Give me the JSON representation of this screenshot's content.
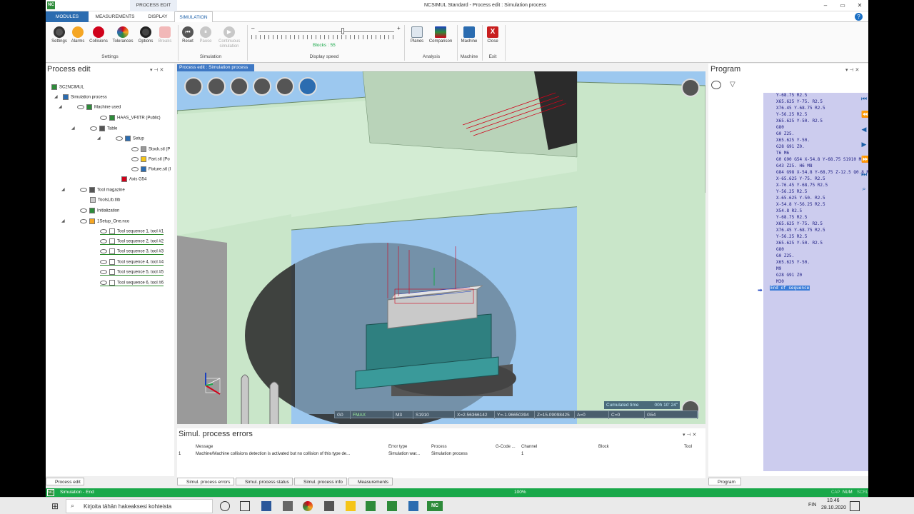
{
  "window": {
    "title": "NCSIMUL Standard - Process edit : Simulation process",
    "context_tab": "PROCESS EDIT",
    "logo": "NC",
    "controls": {
      "minimize": "–",
      "maximize": "▭",
      "close": "✕"
    }
  },
  "ribbon_tabs": [
    "MODULES",
    "MEASUREMENTS",
    "DISPLAY",
    "SIMULATION"
  ],
  "ribbon": {
    "settings_group": {
      "label": "Settings",
      "buttons": [
        "Settings",
        "Alarms",
        "Collisions",
        "Tolerances",
        "Options",
        "Breaks"
      ]
    },
    "simulation_group": {
      "label": "Simulation",
      "buttons": [
        "Reset",
        "Pause",
        "Continuous",
        "simulation"
      ]
    },
    "display_speed": {
      "label": "Display speed",
      "blocks": "Blocks : 55",
      "minus": "–",
      "plus": "+"
    },
    "analysis_group": {
      "label": "Analysis",
      "buttons": [
        "Planes",
        "Comparison"
      ]
    },
    "machine_group": {
      "label": "Machine",
      "buttons": [
        "Machine"
      ]
    },
    "exit_group": {
      "label": "Exit",
      "buttons": [
        "Close"
      ]
    }
  },
  "process_edit": {
    "title": "Process edit",
    "tree": [
      "SC2NCIMUL",
      "Simulation process",
      "Machine used",
      "HAAS_VF6TR (Public)",
      "Table",
      "Setup",
      "Stock.stl (P",
      "Part.stl (Po",
      "Fixture.stl (I",
      "Axis G54",
      "Tool magazine",
      "ToolsLib.tlib",
      "Initialization",
      "1Setup_One.nco",
      "Tool sequence 1, tool #1",
      "Tool sequence 2, tool #2",
      "Tool sequence 3, tool #3",
      "Tool sequence 4, tool #4",
      "Tool sequence 5, tool #5",
      "Tool sequence 6, tool #6"
    ],
    "bottom_tab": "Process edit"
  },
  "viewport": {
    "tab": "Process edit : Simulation process",
    "cumulated_label": "Cumulated time",
    "cumulated_value": "00h 10' 24\"",
    "status": [
      "G0",
      "FMAX",
      "M3",
      "S1910",
      "X=2.56366142",
      "Y=-1.96650394",
      "Z=15.09098425",
      "A=0",
      "C=0",
      "G54"
    ]
  },
  "program": {
    "title": "Program",
    "lines": [
      "Y-68.75 R2.5",
      "X65.625 Y-75. R2.5",
      "X76.45 Y-68.75 R2.5",
      "Y-56.25 R2.5",
      "X65.625 Y-50. R2.5",
      "G80",
      "G0 Z25.",
      "X65.625 Y-50.",
      "G28 G91 Z0.",
      "T6 M6",
      "G0 G90 G54 X-54.8 Y-68.75 S1910 M3",
      "G43 Z25. H6 M8",
      "G84 G98 X-54.8 Y-68.75 Z-12.5 Q0.8 R2.5",
      "X-65.625 Y-75. R2.5",
      "X-76.45 Y-68.75 R2.5",
      "Y-56.25 R2.5",
      "X-65.625 Y-50. R2.5",
      "X-54.8 Y-56.25 R2.5",
      "X54.8 R2.5",
      "Y-68.75 R2.5",
      "X65.625 Y-75. R2.5",
      "X76.45 Y-68.75 R2.5",
      "Y-56.25 R2.5",
      "X65.625 Y-50. R2.5",
      "G80",
      "G0 Z25.",
      "X65.625 Y-50.",
      "M9",
      "G28 G91 Z0",
      "M30",
      "End of sequence"
    ],
    "bottom_tab": "Program"
  },
  "errors": {
    "title": "Simul. process errors",
    "columns": [
      "Message",
      "Error type",
      "Process",
      "G-Code ...",
      "Channel",
      "Block",
      "Tool"
    ],
    "rows": [
      [
        "1",
        "Machine/Machine collisions detection is activated but no collision of this type de...",
        "Simulation war...",
        "Simulation process",
        "",
        "1",
        "",
        ""
      ]
    ],
    "tabs": [
      "Simul. process errors",
      "Simul. process status",
      "Simul. process info",
      "Measurements"
    ]
  },
  "status_strip": {
    "text": "Simulation - End",
    "progress": "100%",
    "indicators": [
      "CAP",
      "NUM",
      "SCRL"
    ]
  },
  "taskbar": {
    "search_placeholder": "Kirjoita tähän hakeaksesi kohteista",
    "lang": "FIN",
    "time": "10.46",
    "date": "28.10.2020",
    "apps": [
      "NC"
    ]
  },
  "colors": {
    "accent": "#2b6cb0",
    "status_green": "#1aa84a",
    "viewport_bg": "#9cc8ef",
    "program_bg": "#ccccee",
    "machine_green": "#c9e6c9"
  }
}
